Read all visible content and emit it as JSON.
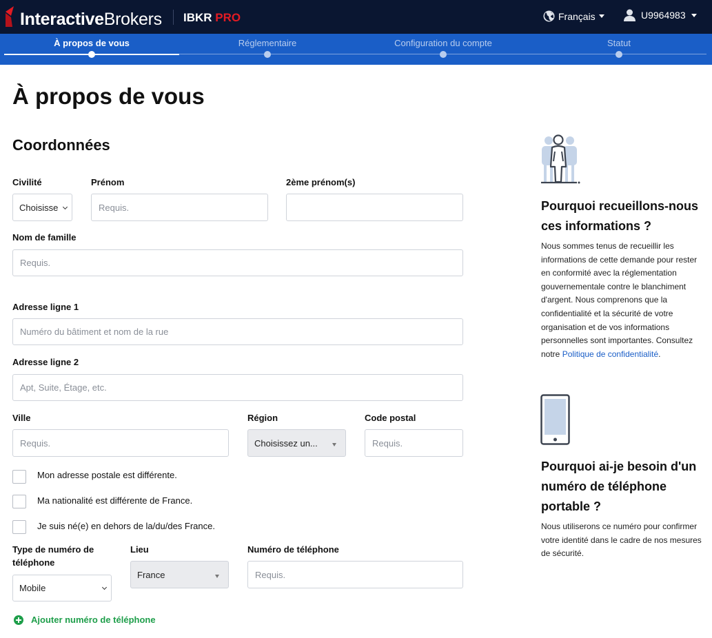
{
  "header": {
    "brand_bold": "Interactive",
    "brand_regular": "Brokers",
    "product": "IBKR",
    "product_pro": "PRO",
    "language": "Français",
    "account": "U9964983",
    "brand_red": "#e31b23",
    "bg_color": "#0a1631"
  },
  "steps": [
    {
      "label": "À propos de vous",
      "active": true
    },
    {
      "label": "Réglementaire",
      "active": false
    },
    {
      "label": "Configuration du compte",
      "active": false
    },
    {
      "label": "Statut",
      "active": false
    }
  ],
  "steps_color": "#1a5ec7",
  "page_title": "À propos de vous",
  "section_title": "Coordonnées",
  "form": {
    "civility": {
      "label": "Civilité",
      "value": "Choisisse"
    },
    "first_name": {
      "label": "Prénom",
      "placeholder": "Requis."
    },
    "middle_name": {
      "label": "2ème prénom(s)",
      "placeholder": ""
    },
    "last_name": {
      "label": "Nom de famille",
      "placeholder": "Requis."
    },
    "address1": {
      "label": "Adresse ligne 1",
      "placeholder": "Numéro du bâtiment et nom de la rue"
    },
    "address2": {
      "label": "Adresse ligne 2",
      "placeholder": "Apt, Suite, Étage, etc."
    },
    "city": {
      "label": "Ville",
      "placeholder": "Requis."
    },
    "region": {
      "label": "Région",
      "value": "Choisissez un..."
    },
    "postal": {
      "label": "Code postal",
      "placeholder": "Requis."
    },
    "checkboxes": [
      "Mon adresse postale est différente.",
      "Ma nationalité est différente de France.",
      "Je suis né(e) en dehors de la/du/des France."
    ],
    "phone_type": {
      "label_line1": "Type de numéro de",
      "label_line2": "téléphone",
      "value": "Mobile"
    },
    "location": {
      "label": "Lieu",
      "value": "France"
    },
    "phone": {
      "label": "Numéro de téléphone",
      "placeholder": "Requis."
    },
    "add_phone": "Ajouter numéro de téléphone"
  },
  "side": {
    "why_info_title": "Pourquoi recueillons-nous ces informations ?",
    "why_info_text": "Nous sommes tenus de recueillir les informations de cette demande pour rester en conformité avec la réglementation gouvernementale contre le blanchiment d'argent. Nous comprenons que la confidentialité et la sécurité de votre organisation et de vos informations personnelles sont importantes. Consultez notre",
    "privacy_link": "Politique de confidentialité",
    "period": ".",
    "why_phone_title": "Pourquoi ai-je besoin d'un numéro de téléphone portable ?",
    "why_phone_text": "Nous utiliserons ce numéro pour confirmer votre identité dans le cadre de nos mesures de sécurité."
  },
  "accent_green": "#1e9e4a"
}
